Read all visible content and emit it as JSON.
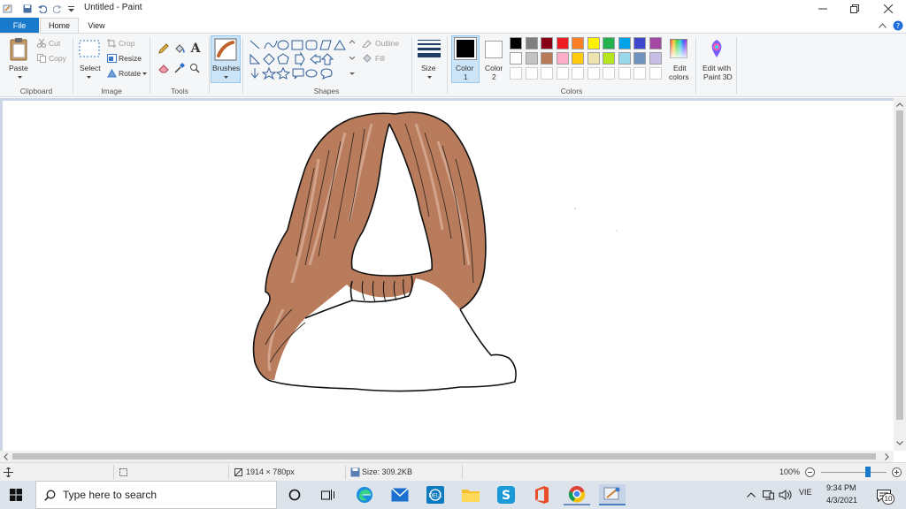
{
  "window": {
    "title": "Untitled - Paint"
  },
  "tabs": {
    "file": "File",
    "home": "Home",
    "view": "View"
  },
  "ribbon": {
    "clipboard": {
      "paste": "Paste",
      "cut": "Cut",
      "copy": "Copy",
      "group": "Clipboard"
    },
    "image": {
      "select": "Select",
      "crop": "Crop",
      "resize": "Resize",
      "rotate": "Rotate",
      "group": "Image"
    },
    "tools": {
      "group": "Tools"
    },
    "brushes": {
      "label": "Brushes"
    },
    "shapes": {
      "outline": "Outline",
      "fill": "Fill",
      "group": "Shapes"
    },
    "size": {
      "label": "Size"
    },
    "colors": {
      "color1": "Color",
      "color1_num": "1",
      "color2": "Color",
      "color2_num": "2",
      "edit_colors_l1": "Edit",
      "edit_colors_l2": "colors",
      "group": "Colors",
      "color1_value": "#000000",
      "color2_value": "#ffffff",
      "palette_row1": [
        "#000000",
        "#7f7f7f",
        "#880015",
        "#ed1c24",
        "#ff7f27",
        "#fff200",
        "#22b14c",
        "#00a2e8",
        "#3f48cc",
        "#a349a4"
      ],
      "palette_row2": [
        "#ffffff",
        "#c3c3c3",
        "#b97a57",
        "#ffaec9",
        "#ffc90e",
        "#efe4b0",
        "#b5e61d",
        "#99d9ea",
        "#7092be",
        "#c8bfe7"
      ]
    },
    "paint3d": {
      "l1": "Edit with",
      "l2": "Paint 3D"
    }
  },
  "status": {
    "dimensions": "1914 × 780px",
    "size": "Size: 309.2KB",
    "zoom": "100%",
    "zoom_fraction": 0.72
  },
  "taskbar": {
    "search_placeholder": "Type here to search",
    "language": "VIE",
    "time": "9:34 PM",
    "date": "4/3/2021",
    "notifications": "10"
  }
}
